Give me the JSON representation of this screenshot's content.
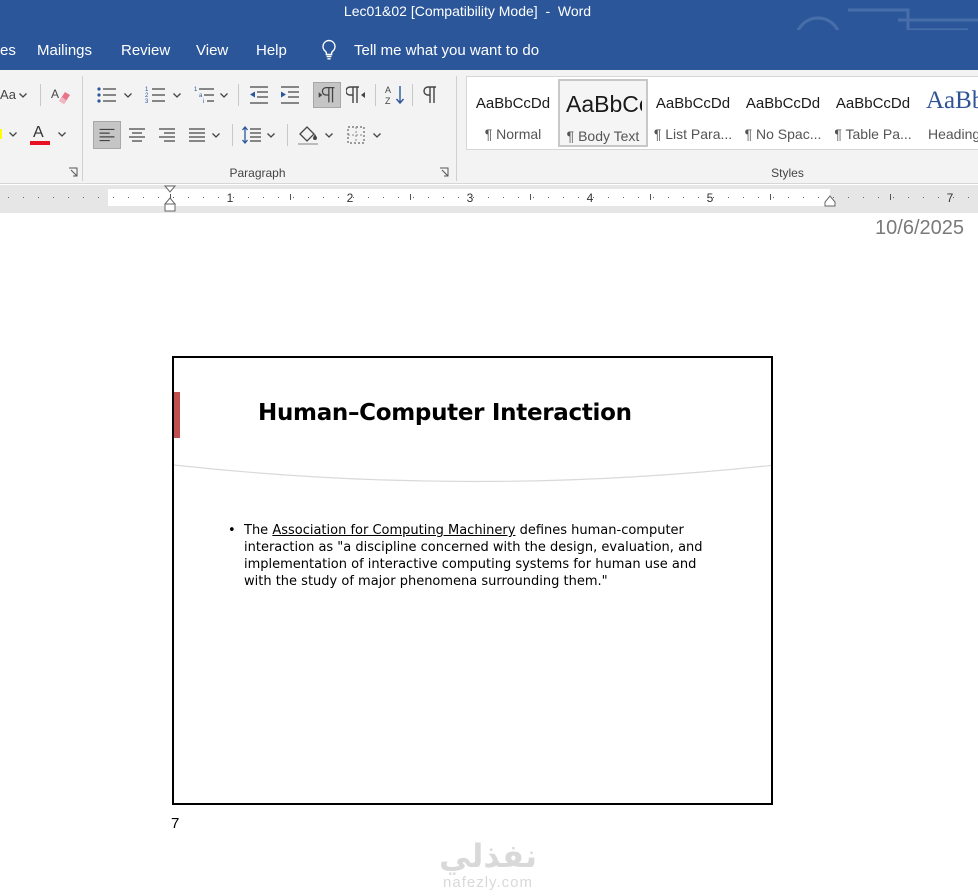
{
  "titlebar": {
    "title": "Lec01&02 [Compatibility Mode]  -  Word"
  },
  "tabs": [
    {
      "label": "es"
    },
    {
      "label": "Mailings"
    },
    {
      "label": "Review"
    },
    {
      "label": "View"
    },
    {
      "label": "Help"
    }
  ],
  "tell_me": {
    "label": "Tell me what you want to do"
  },
  "ribbon": {
    "font_group": {
      "change_case_label": "Aa",
      "font_color": "#e81123"
    },
    "paragraph_group": {
      "label": "Paragraph"
    },
    "styles_group": {
      "label": "Styles"
    }
  },
  "styles": [
    {
      "sample": "AaBbCcDd",
      "name": "¶ Normal",
      "selected": false
    },
    {
      "sample": "AaBbCc",
      "name": "¶ Body Text",
      "selected": true
    },
    {
      "sample": "AaBbCcDd",
      "name": "¶ List Para...",
      "selected": false
    },
    {
      "sample": "AaBbCcDd",
      "name": "¶ No Spac...",
      "selected": false
    },
    {
      "sample": "AaBbCcDd",
      "name": "¶ Table Pa...",
      "selected": false
    },
    {
      "sample": "AaBb",
      "name": "Heading",
      "selected": false
    }
  ],
  "ruler": {
    "numbers": [
      "1",
      "2",
      "3",
      "4",
      "5",
      "7"
    ]
  },
  "document": {
    "header_date": "10/6/2025",
    "slide": {
      "title": "Human–Computer Interaction",
      "bullet_marker": "•",
      "bullet_pre": "The ",
      "bullet_link": "Association for Computing Machinery",
      "bullet_post": " defines human-computer interaction as \"a discipline concerned with the design, evaluation, and implementation of interactive computing systems for human use and with the study of major phenomena surrounding them.\""
    },
    "page_number": "7"
  },
  "watermark": {
    "arabic": "نفذلي",
    "latin": "nafezly.com"
  },
  "colors": {
    "accent": "#2b579a",
    "slide_accent": "#c0504d"
  }
}
